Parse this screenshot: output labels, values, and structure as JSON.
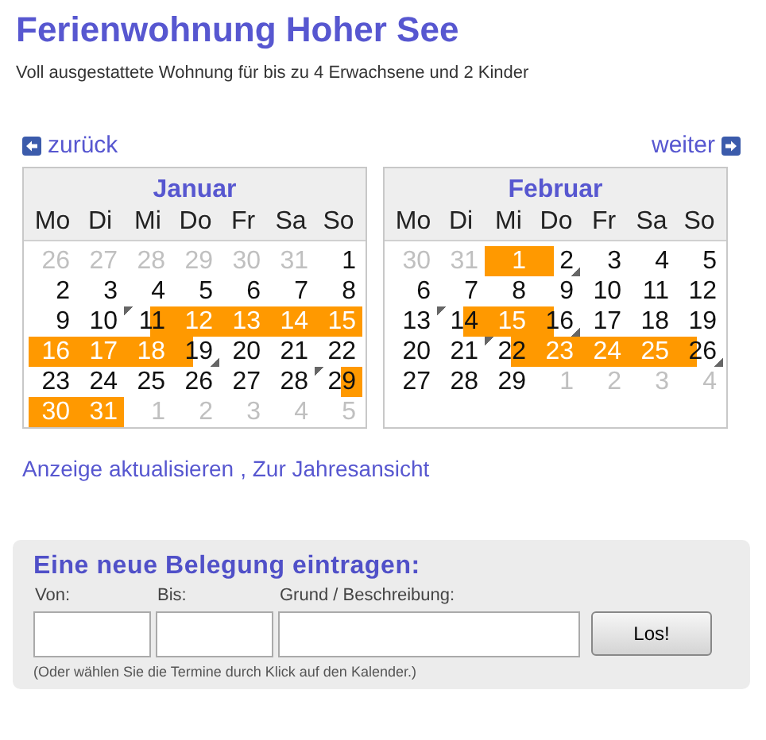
{
  "title": "Ferienwohnung Hoher See",
  "subtitle": "Voll ausgestattete Wohnung für bis zu 4 Erwachsene und 2 Kinder",
  "nav": {
    "prev": "zurück",
    "next": "weiter"
  },
  "months": [
    {
      "name": "Januar",
      "weekdays": [
        "Mo",
        "Di",
        "Mi",
        "Do",
        "Fr",
        "Sa",
        "So"
      ],
      "weeks": [
        [
          {
            "day": "26",
            "outside": true,
            "kind": "free"
          },
          {
            "day": "27",
            "outside": true,
            "kind": "free"
          },
          {
            "day": "28",
            "outside": true,
            "kind": "free"
          },
          {
            "day": "29",
            "outside": true,
            "kind": "free"
          },
          {
            "day": "30",
            "outside": true,
            "kind": "free"
          },
          {
            "day": "31",
            "outside": true,
            "kind": "free"
          },
          {
            "day": "1",
            "outside": false,
            "kind": "free"
          }
        ],
        [
          {
            "day": "2",
            "outside": false,
            "kind": "free"
          },
          {
            "day": "3",
            "outside": false,
            "kind": "free"
          },
          {
            "day": "4",
            "outside": false,
            "kind": "free"
          },
          {
            "day": "5",
            "outside": false,
            "kind": "free"
          },
          {
            "day": "6",
            "outside": false,
            "kind": "free"
          },
          {
            "day": "7",
            "outside": false,
            "kind": "free"
          },
          {
            "day": "8",
            "outside": false,
            "kind": "free"
          }
        ],
        [
          {
            "day": "9",
            "outside": false,
            "kind": "free"
          },
          {
            "day": "10",
            "outside": false,
            "kind": "free"
          },
          {
            "day": "11",
            "outside": false,
            "kind": "arrival"
          },
          {
            "day": "12",
            "outside": false,
            "kind": "booked"
          },
          {
            "day": "13",
            "outside": false,
            "kind": "booked"
          },
          {
            "day": "14",
            "outside": false,
            "kind": "booked"
          },
          {
            "day": "15",
            "outside": false,
            "kind": "booked"
          }
        ],
        [
          {
            "day": "16",
            "outside": false,
            "kind": "booked"
          },
          {
            "day": "17",
            "outside": false,
            "kind": "booked"
          },
          {
            "day": "18",
            "outside": false,
            "kind": "booked"
          },
          {
            "day": "19",
            "outside": false,
            "kind": "departure"
          },
          {
            "day": "20",
            "outside": false,
            "kind": "free"
          },
          {
            "day": "21",
            "outside": false,
            "kind": "free"
          },
          {
            "day": "22",
            "outside": false,
            "kind": "free"
          }
        ],
        [
          {
            "day": "23",
            "outside": false,
            "kind": "free"
          },
          {
            "day": "24",
            "outside": false,
            "kind": "free"
          },
          {
            "day": "25",
            "outside": false,
            "kind": "free"
          },
          {
            "day": "26",
            "outside": false,
            "kind": "free"
          },
          {
            "day": "27",
            "outside": false,
            "kind": "free"
          },
          {
            "day": "28",
            "outside": false,
            "kind": "free"
          },
          {
            "day": "29",
            "outside": false,
            "kind": "arrival"
          }
        ],
        [
          {
            "day": "30",
            "outside": false,
            "kind": "booked"
          },
          {
            "day": "31",
            "outside": false,
            "kind": "booked"
          },
          {
            "day": "1",
            "outside": true,
            "kind": "free"
          },
          {
            "day": "2",
            "outside": true,
            "kind": "free"
          },
          {
            "day": "3",
            "outside": true,
            "kind": "free"
          },
          {
            "day": "4",
            "outside": true,
            "kind": "free"
          },
          {
            "day": "5",
            "outside": true,
            "kind": "free"
          }
        ]
      ]
    },
    {
      "name": "Februar",
      "weekdays": [
        "Mo",
        "Di",
        "Mi",
        "Do",
        "Fr",
        "Sa",
        "So"
      ],
      "weeks": [
        [
          {
            "day": "30",
            "outside": true,
            "kind": "free"
          },
          {
            "day": "31",
            "outside": true,
            "kind": "free"
          },
          {
            "day": "1",
            "outside": false,
            "kind": "booked"
          },
          {
            "day": "2",
            "outside": false,
            "kind": "departure"
          },
          {
            "day": "3",
            "outside": false,
            "kind": "free"
          },
          {
            "day": "4",
            "outside": false,
            "kind": "free"
          },
          {
            "day": "5",
            "outside": false,
            "kind": "free"
          }
        ],
        [
          {
            "day": "6",
            "outside": false,
            "kind": "free"
          },
          {
            "day": "7",
            "outside": false,
            "kind": "free"
          },
          {
            "day": "8",
            "outside": false,
            "kind": "free"
          },
          {
            "day": "9",
            "outside": false,
            "kind": "free"
          },
          {
            "day": "10",
            "outside": false,
            "kind": "free"
          },
          {
            "day": "11",
            "outside": false,
            "kind": "free"
          },
          {
            "day": "12",
            "outside": false,
            "kind": "free"
          }
        ],
        [
          {
            "day": "13",
            "outside": false,
            "kind": "free"
          },
          {
            "day": "14",
            "outside": false,
            "kind": "arrival"
          },
          {
            "day": "15",
            "outside": false,
            "kind": "booked"
          },
          {
            "day": "16",
            "outside": false,
            "kind": "departure"
          },
          {
            "day": "17",
            "outside": false,
            "kind": "free"
          },
          {
            "day": "18",
            "outside": false,
            "kind": "free"
          },
          {
            "day": "19",
            "outside": false,
            "kind": "free"
          }
        ],
        [
          {
            "day": "20",
            "outside": false,
            "kind": "free"
          },
          {
            "day": "21",
            "outside": false,
            "kind": "free"
          },
          {
            "day": "22",
            "outside": false,
            "kind": "arrival"
          },
          {
            "day": "23",
            "outside": false,
            "kind": "booked"
          },
          {
            "day": "24",
            "outside": false,
            "kind": "booked"
          },
          {
            "day": "25",
            "outside": false,
            "kind": "booked"
          },
          {
            "day": "26",
            "outside": false,
            "kind": "departure"
          }
        ],
        [
          {
            "day": "27",
            "outside": false,
            "kind": "free"
          },
          {
            "day": "28",
            "outside": false,
            "kind": "free"
          },
          {
            "day": "29",
            "outside": false,
            "kind": "free"
          },
          {
            "day": "1",
            "outside": true,
            "kind": "free"
          },
          {
            "day": "2",
            "outside": true,
            "kind": "free"
          },
          {
            "day": "3",
            "outside": true,
            "kind": "free"
          },
          {
            "day": "4",
            "outside": true,
            "kind": "free"
          }
        ]
      ]
    }
  ],
  "links": [
    {
      "text": "Anzeige aktualisieren"
    },
    {
      "text": ", Zur Jahresansicht"
    }
  ],
  "form": {
    "heading": "Eine neue Belegung eintragen:",
    "fields": [
      {
        "label": "Von:",
        "kind": "date"
      },
      {
        "label": "Bis:",
        "kind": "date"
      },
      {
        "label": "Grund / Beschreibung:",
        "kind": "text"
      }
    ],
    "button": "Los!",
    "hint": "(Oder wählen Sie die Termine durch Klick auf den Kalender.)"
  }
}
